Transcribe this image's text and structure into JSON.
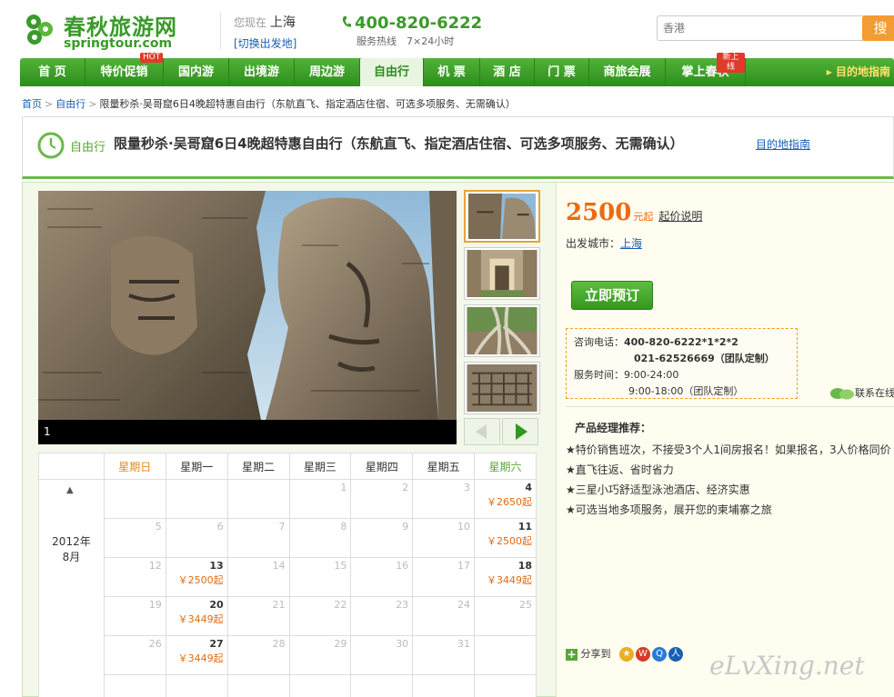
{
  "brand": {
    "name_cn": "春秋旅游网",
    "domain": "springtour.com"
  },
  "location": {
    "prefix": "您现在",
    "city": "上海",
    "switch_label": "[切换出发地]"
  },
  "hotline": {
    "number": "400-820-6222",
    "caption": "服务热线　7×24小时"
  },
  "search": {
    "placeholder": "香港",
    "button": "搜"
  },
  "nav": {
    "items": [
      {
        "label": "首 页"
      },
      {
        "label": "特价促销",
        "badge": "HOT"
      },
      {
        "label": "国内游"
      },
      {
        "label": "出境游"
      },
      {
        "label": "周边游"
      },
      {
        "label": "自由行",
        "active": true
      },
      {
        "label": "机 票"
      },
      {
        "label": "酒 店"
      },
      {
        "label": "门 票"
      },
      {
        "label": "商旅会展"
      },
      {
        "label": "掌上春秋",
        "badge": "新上线"
      }
    ],
    "guide": "目的地指南"
  },
  "breadcrumb": {
    "home": "首页",
    "section": "自由行",
    "current": "限量秒杀·吴哥窟6日4晚超特惠自由行（东航直飞、指定酒店住宿、可选多项服务、无需确认）"
  },
  "title": {
    "kind": "自由行",
    "text": "限量秒杀·吴哥窟6日4晚超特惠自由行（东航直飞、指定酒店住宿、可选多项服务、无需确认）",
    "guide_link": "目的地指南"
  },
  "gallery": {
    "caption": "1",
    "selected_thumb": 1,
    "thumb_count": 4
  },
  "calendar": {
    "weekdays": [
      "星期日",
      "星期一",
      "星期二",
      "星期三",
      "星期四",
      "星期五",
      "星期六"
    ],
    "month_label": "2012年\n8月",
    "year": "2012年",
    "month": "8月",
    "weeks": [
      [
        {
          "d": ""
        },
        {
          "d": ""
        },
        {
          "d": ""
        },
        {
          "d": "1"
        },
        {
          "d": "2"
        },
        {
          "d": "3"
        },
        {
          "d": "4",
          "price": "￥2650起"
        }
      ],
      [
        {
          "d": "5"
        },
        {
          "d": "6"
        },
        {
          "d": "7"
        },
        {
          "d": "8"
        },
        {
          "d": "9"
        },
        {
          "d": "10"
        },
        {
          "d": "11",
          "price": "￥2500起"
        }
      ],
      [
        {
          "d": "12"
        },
        {
          "d": "13",
          "price": "￥2500起"
        },
        {
          "d": "14"
        },
        {
          "d": "15"
        },
        {
          "d": "16"
        },
        {
          "d": "17"
        },
        {
          "d": "18",
          "price": "￥3449起"
        }
      ],
      [
        {
          "d": "19"
        },
        {
          "d": "20",
          "price": "￥3449起"
        },
        {
          "d": "21"
        },
        {
          "d": "22"
        },
        {
          "d": "23"
        },
        {
          "d": "24"
        },
        {
          "d": "25"
        }
      ],
      [
        {
          "d": "26"
        },
        {
          "d": "27",
          "price": "￥3449起"
        },
        {
          "d": "28"
        },
        {
          "d": "29"
        },
        {
          "d": "30"
        },
        {
          "d": "31"
        },
        {
          "d": ""
        }
      ],
      [
        {
          "d": ""
        },
        {
          "d": ""
        },
        {
          "d": ""
        },
        {
          "d": ""
        },
        {
          "d": ""
        },
        {
          "d": ""
        },
        {
          "d": ""
        }
      ]
    ]
  },
  "product": {
    "price": "2500",
    "price_unit": "元起",
    "price_explain": "起价说明",
    "depart_label": "出发城市：",
    "depart_city": "上海",
    "book_button": "立即预订"
  },
  "contact": {
    "phone_label": "咨询电话：",
    "phone1": "400-820-6222*1*2*2",
    "phone2": "021-62526669（团队定制）",
    "hours_label": "服务时间：",
    "hours1": "9:00-24:00",
    "hours2": "9:00-18:00（团队定制）"
  },
  "online": "联系在线",
  "recommend": {
    "heading": "产品经理推荐：",
    "lines": [
      "★特价销售班次，不接受3个人1间房报名！如果报名，3人价格同价",
      "★直飞往返、省时省力",
      "★三星小巧舒适型泳池酒店、经济实惠",
      "★可选当地多项服务，展开您的柬埔寨之旅"
    ]
  },
  "share": {
    "label": "分享到"
  },
  "watermark": "eLvXing.net",
  "colors": {
    "brand_green": "#3a9a2a",
    "price_orange": "#ee6a10",
    "link_blue": "#1a5fb4"
  }
}
